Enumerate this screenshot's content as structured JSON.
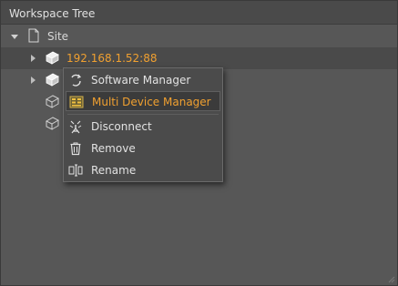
{
  "panel": {
    "title": "Workspace Tree"
  },
  "tree": {
    "root": {
      "label": "Site",
      "expanded": true
    },
    "devices": [
      {
        "label": "192.168.1.52:88",
        "selected": true,
        "state": "online"
      },
      {
        "label": "",
        "selected": false,
        "state": "online"
      },
      {
        "label": "",
        "selected": false,
        "state": "offline"
      },
      {
        "label": "",
        "selected": false,
        "state": "offline"
      }
    ]
  },
  "context_menu": {
    "items": [
      {
        "label": "Software Manager",
        "icon": "refresh-icon",
        "highlighted": false
      },
      {
        "label": "Multi Device Manager",
        "icon": "multi-device-icon",
        "highlighted": true
      },
      {
        "label": "Disconnect",
        "icon": "disconnect-icon",
        "highlighted": false
      },
      {
        "label": "Remove",
        "icon": "trash-icon",
        "highlighted": false
      },
      {
        "label": "Rename",
        "icon": "rename-icon",
        "highlighted": false
      }
    ]
  },
  "colors": {
    "accent": "#f0a030",
    "panel_bg": "#575757",
    "header_bg": "#4a4a4a",
    "menu_bg": "#4b4b4b",
    "text": "#e2e2e2"
  }
}
